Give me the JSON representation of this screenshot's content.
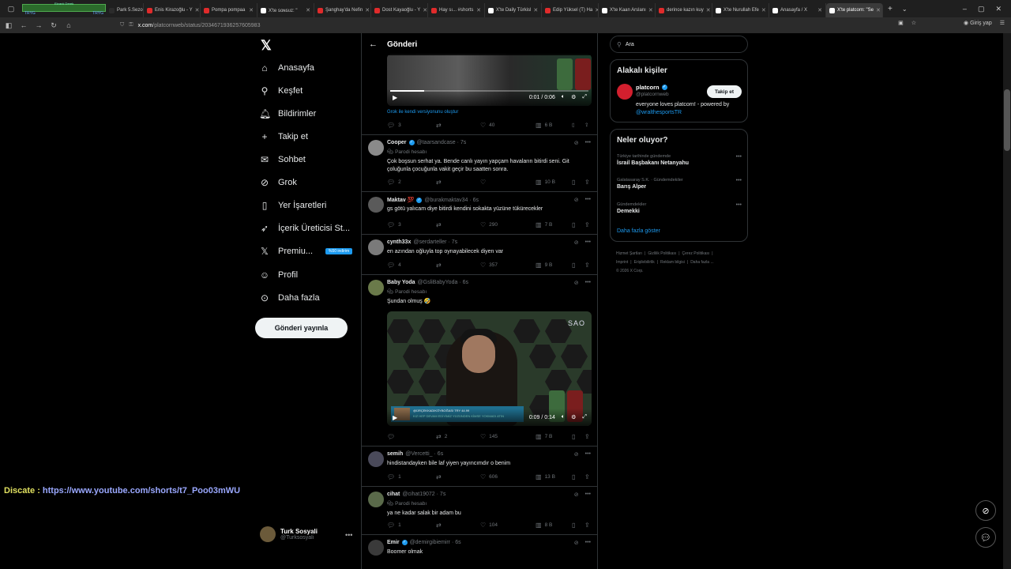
{
  "browser": {
    "overlay": {
      "label": "Ekranlı Derek",
      "left_tag": "TRYG",
      "right_tag": "TRYG"
    },
    "tabs": [
      {
        "label": "Park 5.Sezon",
        "color": "#2b2b2b"
      },
      {
        "label": "Enis Kirazoğlu - Y",
        "color": "#e02b2b"
      },
      {
        "label": "Pompa pompaa",
        "color": "#e02b2b"
      },
      {
        "label": "X'te ꜱᴏɴꜱᴜᴢ: \"",
        "color": "#ffffff"
      },
      {
        "label": "Şanghay'da Nefin",
        "color": "#e02b2b"
      },
      {
        "label": "Dost Kayaoğlu - Y",
        "color": "#e02b2b"
      },
      {
        "label": "Hay sı... #shorts",
        "color": "#e02b2b"
      },
      {
        "label": "X'te Daily Türkisl",
        "color": "#ffffff"
      },
      {
        "label": "Edip Yüksel (T) Ha",
        "color": "#e02b2b"
      },
      {
        "label": "X'te Kaan Arslanı",
        "color": "#ffffff"
      },
      {
        "label": "derince kazın kuy",
        "color": "#e02b2b"
      },
      {
        "label": "X'te Nurullah Efe",
        "color": "#ffffff"
      },
      {
        "label": "Anasayfa / X",
        "color": "#ffffff"
      },
      {
        "label": "X'te platcorn: \"Se",
        "color": "#ffffff"
      }
    ],
    "url_domain": "x.com",
    "url_rest": "/platcornweb/status/2034671936257605983",
    "login_label": "Giriş yap"
  },
  "sidebar": {
    "items": [
      {
        "label": "Anasayfa",
        "icon": "home-icon",
        "glyph": "⌂"
      },
      {
        "label": "Keşfet",
        "icon": "search-icon",
        "glyph": "⚲"
      },
      {
        "label": "Bildirimler",
        "icon": "bell-icon",
        "glyph": "🔔︎"
      },
      {
        "label": "Takip et",
        "icon": "add-user-icon",
        "glyph": "+"
      },
      {
        "label": "Sohbet",
        "icon": "mail-icon",
        "glyph": "✉"
      },
      {
        "label": "Grok",
        "icon": "grok-icon",
        "glyph": "⊘"
      },
      {
        "label": "Yer İşaretleri",
        "icon": "bookmark-icon",
        "glyph": "▯"
      },
      {
        "label": "İçerik Üreticisi St...",
        "icon": "rocket-icon",
        "glyph": "➶"
      },
      {
        "label": "Premiu...",
        "icon": "x-premium-icon",
        "glyph": "𝕏",
        "badge": "%50 indirim"
      },
      {
        "label": "Profil",
        "icon": "profile-icon",
        "glyph": "☺"
      },
      {
        "label": "Daha fazla",
        "icon": "more-circle-icon",
        "glyph": "⊙"
      }
    ],
    "post_button": "Gönderi yayınla",
    "account": {
      "name": "Turk Sosyali",
      "handle": "@Turksosyali"
    }
  },
  "main": {
    "title": "Gönderi",
    "first_video": {
      "time": "0:01 / 0:06",
      "progress": 0.17
    },
    "grok_link": "Grok ile kendi versiyonunu oluştur",
    "first_stats": {
      "replies": "3",
      "reposts": "",
      "likes": "40",
      "views": "6 B"
    },
    "tweets": [
      {
        "name": "Cooper",
        "verified": true,
        "handle": "@taarsandcase · 7s",
        "parodi": "Parodi hesabı",
        "text": "Çok boşsun serhat ya. Bende canlı yayın yapçam havaların bitirdi seni. Git çoluğunla çocuğunla vakit geçir bu saatten sonra.",
        "replies": "2",
        "reposts": "",
        "likes": "",
        "views": "10 B"
      },
      {
        "name": "Maktav 💯",
        "verified": true,
        "handle": "@burakmaktav34 · 6s",
        "parodi": "",
        "text": "gs götü yalıcam diye bitirdi kendini sokakta yüzüne tükürecekler",
        "replies": "3",
        "reposts": "",
        "likes": "290",
        "views": "7 B"
      },
      {
        "name": "cynth33x",
        "verified": false,
        "handle": "@serdarteller · 7s",
        "parodi": "",
        "text": "en azından oğluyla top oynayabilecek diyen var",
        "replies": "4",
        "reposts": "",
        "likes": "357",
        "views": "9 B"
      },
      {
        "name": "Baby Yoda",
        "verified": false,
        "handle": "@GsliBabyYoda · 6s",
        "parodi": "Parodi hesabı",
        "text": "Şundan olmuş 🤣",
        "replies": "",
        "reposts": "2",
        "likes": "145",
        "views": "7 B"
      },
      {
        "name": "semih",
        "verified": false,
        "handle": "@Vercetti_ · 6s",
        "parodi": "",
        "text": "hindistandayken bile laf yiyen yayıncımdır o benim",
        "replies": "1",
        "reposts": "",
        "likes": "606",
        "views": "13 B"
      },
      {
        "name": "cihat",
        "verified": false,
        "handle": "@cihat19072 · 7s",
        "parodi": "Parodi hesabı",
        "text": "ya ne kadar salak bir adam bu",
        "replies": "1",
        "reposts": "",
        "likes": "104",
        "views": "8 B"
      },
      {
        "name": "Emir",
        "verified": true,
        "handle": "@demirgibiemirr · 6s",
        "parodi": "",
        "text": "Boomer olmak"
      }
    ],
    "second_video": {
      "time": "0:09 / 0:14",
      "brand": "SAO",
      "banner_line1": "@ÜRÇEKKADIKÖYBOĞASI TRY 44.99",
      "banner_line2": "KIZ HEP DEVAM EDİYİMİZ YÜZÜNDEN KİMSE YOKMADI ATIN"
    }
  },
  "right": {
    "search_placeholder": "Ara",
    "related_title": "Alakalı kişiler",
    "related": {
      "name": "platcorn",
      "handle": "@platcornweb",
      "follow": "Takip et",
      "bio": "everyone loves platcorn! - powered by",
      "bio_link": "@wralthesportsTR"
    },
    "trends_title": "Neler oluyor?",
    "trends": [
      {
        "meta": "Türkiye tarihinde gündemde",
        "title": "İsrail Başbakanı Netanyahu"
      },
      {
        "meta": "Galatasaray S.K. · Gündemdekiler",
        "title": "Barış Alper"
      },
      {
        "meta": "Gündemdekiler",
        "title": "Demekki"
      }
    ],
    "show_more": "Daha fazla göster",
    "footer": [
      "Hizmet Şartları",
      "Gizlilik Politikası",
      "Çerez Politikası",
      "Imprint",
      "Erişilebilirlik",
      "Reklam bilgisi",
      "Daha fazla ...",
      "© 2026 X Corp."
    ]
  },
  "overlay": {
    "discate_label": "Discate :",
    "discate_url": "https://www.youtube.com/shorts/t7_Poo03mWU"
  }
}
